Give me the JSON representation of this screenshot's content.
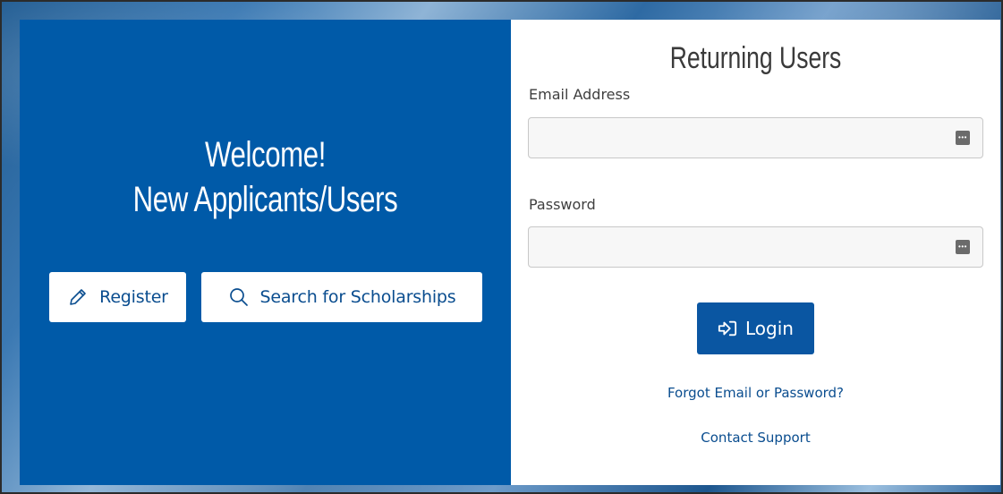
{
  "left_panel": {
    "welcome_line1": "Welcome!",
    "welcome_line2": "New Applicants/Users",
    "register_label": "Register",
    "register_icon": "pencil-icon",
    "search_label": "Search for Scholarships",
    "search_icon": "search-icon",
    "background_color": "#005aa8"
  },
  "login_panel": {
    "title": "Returning Users",
    "email_label": "Email Address",
    "email_value": "",
    "password_label": "Password",
    "password_value": "",
    "field_icon": "password-manager-icon",
    "login_label": "Login",
    "login_icon": "sign-in-icon",
    "forgot_link": "Forgot Email or Password?",
    "support_link": "Contact Support",
    "accent_color": "#0a56a2"
  }
}
